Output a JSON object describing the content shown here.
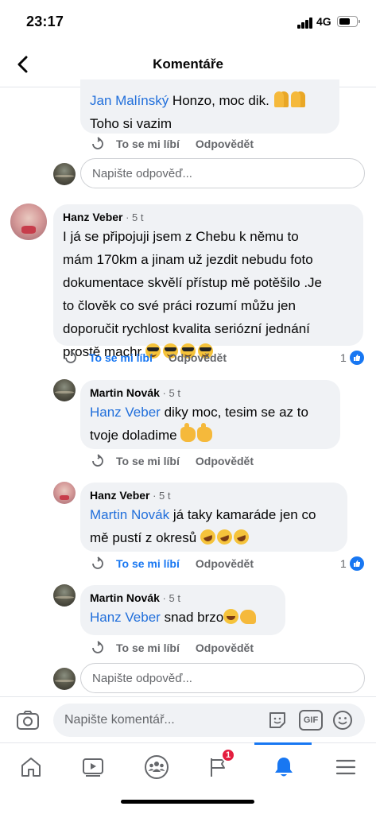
{
  "status": {
    "time": "23:17",
    "network": "4G"
  },
  "header": {
    "title": "Komentáře"
  },
  "actions": {
    "like": "To se mi líbí",
    "reply": "Odpovědět"
  },
  "placeholders": {
    "reply": "Napište odpověď...",
    "comment": "Napište komentář..."
  },
  "comments": [
    {
      "author": "Jan Malínský",
      "mention": "Jan Malínský",
      "line1": " Honzo, moc dik. ",
      "line2": "Toho si vazim"
    },
    {
      "author": "Hanz Veber",
      "time": "5 t",
      "lines": [
        "I já se připojuji jsem z Chebu k němu  to",
        "mám  170km a jinam  už jezdit  nebudu foto",
        "dokumentace skvělí přístup mě  potěšilo .Je",
        "to člověk  co své práci  rozumí můžu  jen",
        "doporučit rychlost kvalita seriózní jednání",
        "prostě machr "
      ],
      "likes": "1"
    },
    {
      "author": "Martin Novák",
      "time": "5 t",
      "mention": "Hanz Veber",
      "line1": " diky moc, tesim se az to",
      "line2": "tvoje doladime "
    },
    {
      "author": "Hanz Veber",
      "time": "5 t",
      "mention": "Martin Novák",
      "line1": " já taky kamaráde jen co",
      "line2": "mě  pustí z okresů ",
      "likes": "1"
    },
    {
      "author": "Martin Novák",
      "time": "5 t",
      "mention": "Hanz Veber",
      "line1": " snad brzo"
    }
  ],
  "composer": {
    "gif_label": "GIF"
  },
  "tabbar": {
    "notification_count": "1"
  },
  "colors": {
    "accent": "#1877f2",
    "mention": "#216fdb",
    "bubble": "#f0f2f5",
    "badge": "#e41e3f"
  }
}
